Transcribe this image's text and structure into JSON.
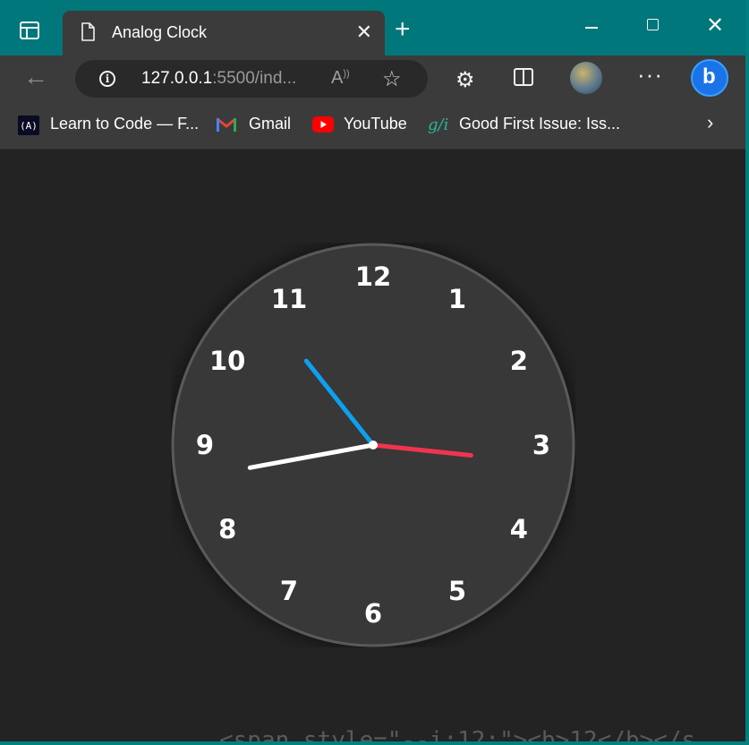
{
  "tab": {
    "title": "Analog Clock",
    "close": "✕"
  },
  "new_tab": "+",
  "window_controls": {
    "close": "✕"
  },
  "address": {
    "host": "127.0.0.1",
    "rest": ":5500/ind..."
  },
  "bookmarks": [
    {
      "label": "Learn to Code — F...",
      "icon": "freecodecamp-icon"
    },
    {
      "label": "Gmail",
      "icon": "gmail-icon"
    },
    {
      "label": "YouTube",
      "icon": "youtube-icon"
    },
    {
      "label": "Good First Issue: Iss...",
      "icon": "gfi-icon"
    }
  ],
  "clock": {
    "numbers": [
      "12",
      "1",
      "2",
      "3",
      "4",
      "5",
      "6",
      "7",
      "8",
      "9",
      "10",
      "11"
    ],
    "time": {
      "hour": 10,
      "minute": 43,
      "second": 16
    },
    "colors": {
      "face": "#383838",
      "border": "#5a5a5a",
      "hour_hand": "#0ea0f0",
      "minute_hand": "#ffffff",
      "second_hand": "#f0344f",
      "numbers": "#ffffff"
    }
  },
  "colors": {
    "accent": "#008080",
    "toolbar": "#3b3b3b",
    "page_background": "#232323"
  }
}
